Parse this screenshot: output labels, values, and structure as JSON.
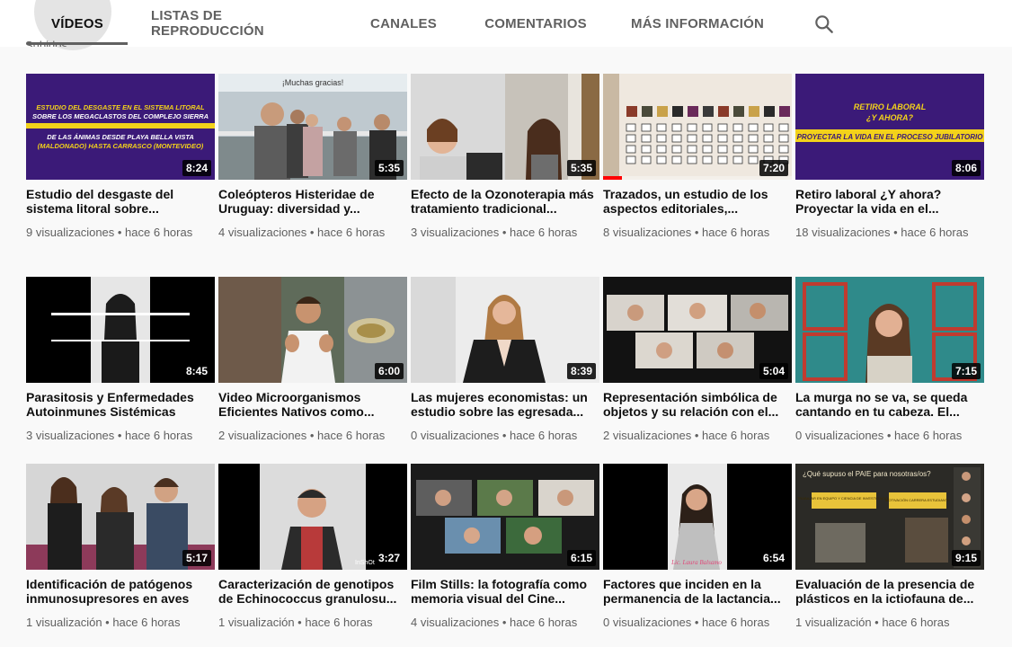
{
  "tabs": [
    {
      "label": "VÍDEOS"
    },
    {
      "label": "LISTAS DE REPRODUCCIÓN"
    },
    {
      "label": "CANALES"
    },
    {
      "label": "COMENTARIOS"
    },
    {
      "label": "MÁS INFORMACIÓN"
    }
  ],
  "search_icon": "search-icon",
  "cutoff_text": "Subidos",
  "colors": {
    "accent": "#ff0000",
    "text": "#0f0f0f",
    "muted": "#606060",
    "background": "#f9f9f9"
  },
  "videos": [
    {
      "title": "Estudio del desgaste del sistema litoral sobre...",
      "duration": "8:24",
      "meta": "9 visualizaciones • hace 6 horas",
      "thumb_text": [
        "ESTUDIO DEL DESGASTE EN EL SISTEMA LITORAL",
        "SOBRE LOS MEGACLASTOS DEL COMPLEJO SIERRA",
        "DE LAS ÁNIMAS DESDE PLAYA BELLA VISTA",
        "(MALDONADO) HASTA CARRASCO (MONTEVIDEO)"
      ]
    },
    {
      "title": "Coleópteros Histeridae de Uruguay: diversidad y...",
      "duration": "5:35",
      "meta": "4 visualizaciones • hace 6 horas",
      "thumb_text": [
        "¡Muchas gracias!"
      ]
    },
    {
      "title": "Efecto de la Ozonoterapia más tratamiento tradicional...",
      "duration": "5:35",
      "meta": "3 visualizaciones • hace 6 horas"
    },
    {
      "title": "Trazados, un estudio de los aspectos editoriales,...",
      "duration": "7:20",
      "meta": "8 visualizaciones • hace 6 horas",
      "watched": 0.1
    },
    {
      "title": "Retiro laboral ¿Y ahora? Proyectar la vida en el...",
      "duration": "8:06",
      "meta": "18 visualizaciones • hace 6 horas",
      "thumb_text": [
        "RETIRO LABORAL",
        "¿Y AHORA?",
        "PROYECTAR LA VIDA EN EL PROCESO JUBILATORIO"
      ]
    },
    {
      "title": "Parasitosis y Enfermedades Autoinmunes Sistémicas",
      "duration": "8:45",
      "meta": "3 visualizaciones • hace 6 horas"
    },
    {
      "title": "Video Microorganismos Eficientes Nativos como...",
      "duration": "6:00",
      "meta": "2 visualizaciones • hace 6 horas"
    },
    {
      "title": "Las mujeres economistas: un estudio sobre las egresada...",
      "duration": "8:39",
      "meta": "0 visualizaciones • hace 6 horas"
    },
    {
      "title": "Representación simbólica de objetos y su relación con el...",
      "duration": "5:04",
      "meta": "2 visualizaciones • hace 6 horas"
    },
    {
      "title": "La murga no se va, se queda cantando en tu cabeza. El...",
      "duration": "7:15",
      "meta": "0 visualizaciones • hace 6 horas"
    },
    {
      "title": "Identificación de patógenos inmunosupresores en aves",
      "duration": "5:17",
      "meta": "1 visualización • hace 6 horas"
    },
    {
      "title": "Caracterización de genotipos de Echinococcus granulosu...",
      "duration": "3:27",
      "meta": "1 visualización • hace 6 horas",
      "thumb_text": [
        "InShOt"
      ]
    },
    {
      "title": "Film Stills: la fotografía como memoria visual del Cine...",
      "duration": "6:15",
      "meta": "4 visualizaciones • hace 6 horas"
    },
    {
      "title": "Factores que inciden en la permanencia de la lactancia...",
      "duration": "6:54",
      "meta": "0 visualizaciones • hace 6 horas",
      "thumb_text": [
        "Lic. Laura Balsamo"
      ]
    },
    {
      "title": "Evaluación de la presencia de plásticos en la ictiofauna de...",
      "duration": "9:15",
      "meta": "1 visualización • hace 6 horas",
      "thumb_text": [
        "¿Qué supuso el PAIE para nosotras/os?",
        "TRABAJAR EN EQUIPO Y CIENCIA DE INVESTIGACIÓN",
        "MOTIVACIÓN CARRERA ESTUDIANTE"
      ]
    }
  ]
}
